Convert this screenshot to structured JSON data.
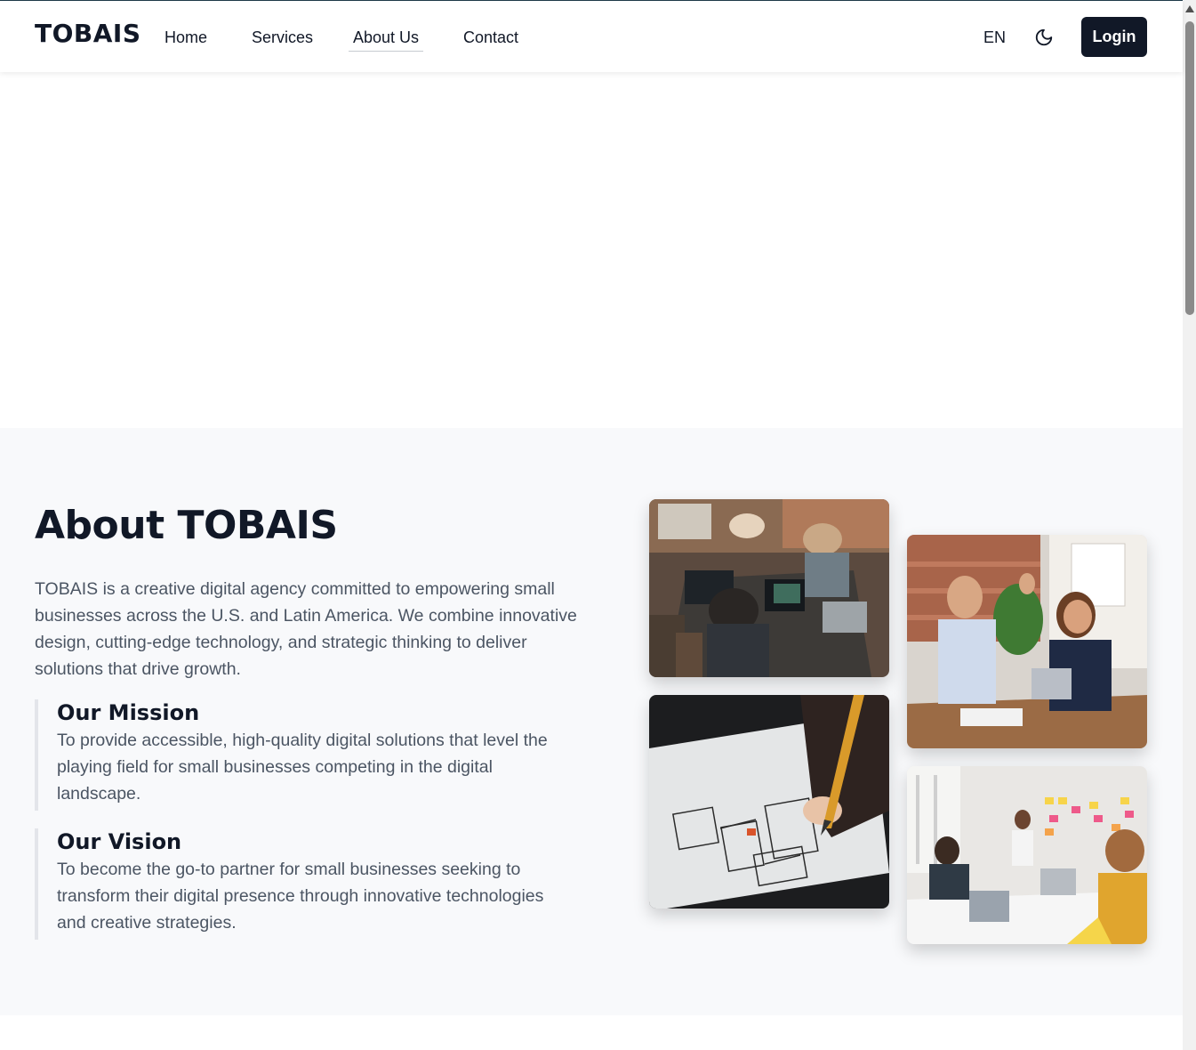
{
  "nav": {
    "logo": "TOBAIS",
    "links": [
      "Home",
      "Services",
      "About Us",
      "Contact"
    ],
    "active": "About Us",
    "language": "EN",
    "theme_icon": "moon-icon",
    "login_label": "Login"
  },
  "about": {
    "title": "About TOBAIS",
    "description": "TOBAIS is a creative digital agency committed to empowering small businesses across the U.S. and Latin America. We combine innovative design, cutting-edge technology, and strategic thinking to deliver solutions that drive growth.",
    "mission": {
      "title": "Our Mission",
      "text": "To provide accessible, high-quality digital solutions that level the playing field for small businesses competing in the digital landscape."
    },
    "vision": {
      "title": "Our Vision",
      "text": "To become the go-to partner for small businesses seeking to transform their digital presence through innovative technologies and creative strategies."
    }
  },
  "colors": {
    "primary": "#111827",
    "text_muted": "#4b5563",
    "section_bg": "#f8f9fb"
  }
}
